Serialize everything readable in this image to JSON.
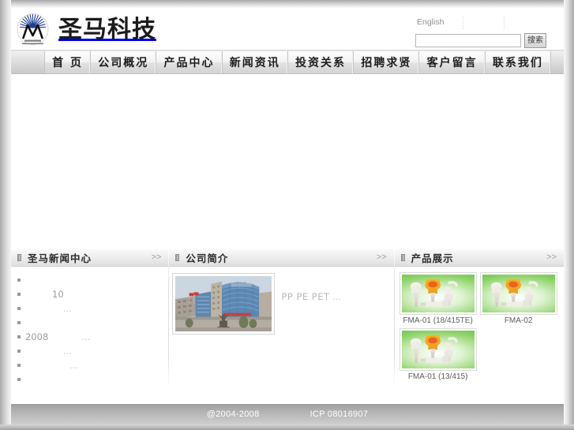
{
  "site": {
    "logo_text": "圣马科技",
    "logo_icon": "sunburst-logo-icon"
  },
  "header": {
    "language_link": "English",
    "search": {
      "value": "",
      "placeholder": "",
      "button_label": "搜索"
    }
  },
  "nav": {
    "items": [
      {
        "label": "首 页"
      },
      {
        "label": "公司概况"
      },
      {
        "label": "产品中心"
      },
      {
        "label": "新闻资讯"
      },
      {
        "label": "投资关系"
      },
      {
        "label": "招聘求贤"
      },
      {
        "label": "客户留言"
      },
      {
        "label": "联系我们"
      }
    ]
  },
  "panels": {
    "news": {
      "title": "圣马新闻中心",
      "more_label": ">>",
      "items": [
        {
          "text": "",
          "ellipsis": ""
        },
        {
          "text": "10",
          "ellipsis": ""
        },
        {
          "text": "",
          "ellipsis": "..."
        },
        {
          "text": "",
          "ellipsis": ""
        },
        {
          "text": "2008",
          "ellipsis": "..."
        },
        {
          "text": "",
          "ellipsis": "..."
        },
        {
          "text": "",
          "ellipsis": "..."
        },
        {
          "text": "",
          "ellipsis": ""
        }
      ]
    },
    "about": {
      "title": "公司简介",
      "more_label": ">>",
      "photo_alt": "company-building-photo",
      "text_materials": "PP PE PET",
      "text_ellipsis": "..."
    },
    "products": {
      "title": "产品展示",
      "more_label": ">>",
      "items": [
        {
          "label": "FMA-01 (18/415TE)"
        },
        {
          "label": "FMA-02"
        },
        {
          "label": "FMA-01 (13/415)"
        }
      ]
    }
  },
  "footer": {
    "copyright": "@2004-2008",
    "icp": "ICP 08016907"
  },
  "colors": {
    "logo_blue": "#1c3f94",
    "nav_text": "#1c1c1c",
    "footer_bg": "#b4b4b4",
    "product_bg_green": "#4fb83a"
  }
}
